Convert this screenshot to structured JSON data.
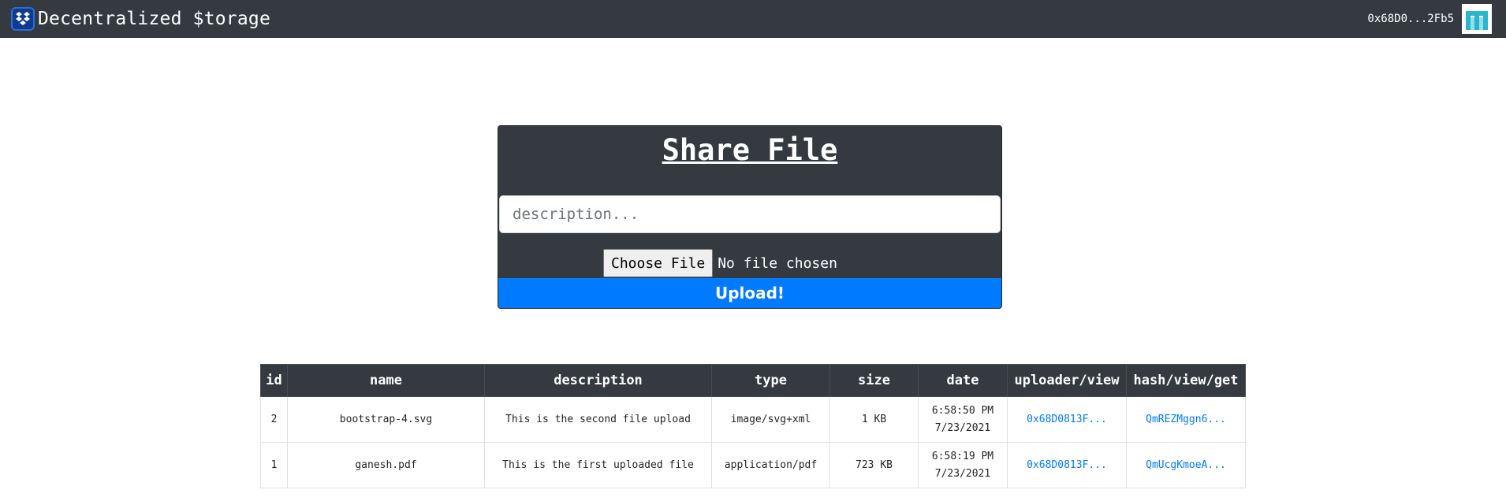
{
  "navbar": {
    "brand_title": "Decentralized $torage",
    "account_address": "0x68D0...2Fb5",
    "brand_icon": "dropbox-icon",
    "identicon": "account-identicon"
  },
  "share_form": {
    "title": "Share File",
    "description_placeholder": "description...",
    "choose_file_label": "Choose File",
    "no_file_text": "No file chosen",
    "upload_label": "Upload!"
  },
  "table": {
    "headers": [
      "id",
      "name",
      "description",
      "type",
      "size",
      "date",
      "uploader/view",
      "hash/view/get"
    ],
    "rows": [
      {
        "id": "2",
        "name": "bootstrap-4.svg",
        "description": "This is the second file upload",
        "type": "image/svg+xml",
        "size": "1 KB",
        "time": "6:58:50 PM",
        "date": "7/23/2021",
        "uploader": "0x68D0813F...",
        "hash": "QmREZMggn6..."
      },
      {
        "id": "1",
        "name": "ganesh.pdf",
        "description": "This is the first uploaded file",
        "type": "application/pdf",
        "size": "723 KB",
        "time": "6:58:19 PM",
        "date": "7/23/2021",
        "uploader": "0x68D0813F...",
        "hash": "QmUcgKmoeA..."
      }
    ]
  },
  "colors": {
    "navbar_bg": "#343a40",
    "primary": "#007bff",
    "identicon": "#2bb5c9"
  }
}
